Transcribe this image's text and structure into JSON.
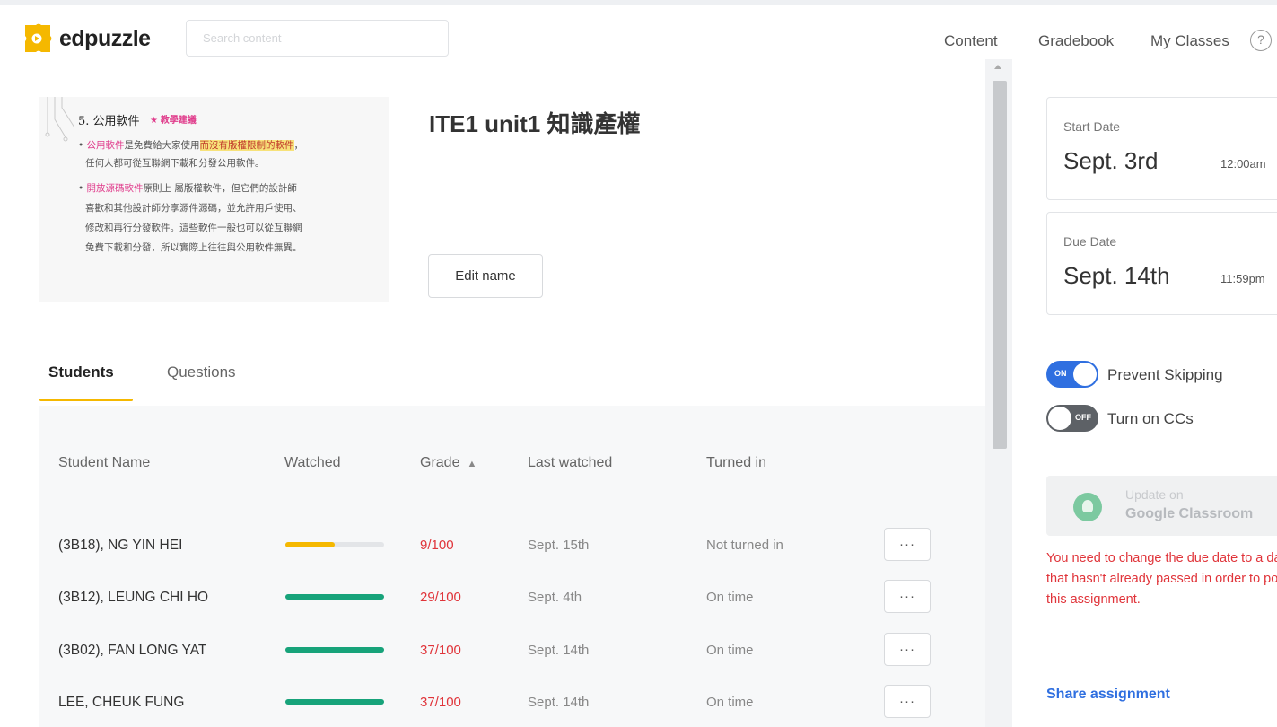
{
  "brand": {
    "name": "edpuzzle",
    "logo_color": "#f5b800"
  },
  "search": {
    "placeholder": "Search content"
  },
  "nav": {
    "links": [
      "Content",
      "Gradebook",
      "My Classes"
    ],
    "help_glyph": "?"
  },
  "assignment": {
    "title": "ITE1 unit1 知識產權",
    "edit_button": "Edit name",
    "thumbnail": {
      "heading": "5. 公用軟件",
      "tag": "★ 教學建議",
      "lines": [
        {
          "pre": "• ",
          "pink": "公用軟件",
          "mid": "是免費給大家使用",
          "hl": "而沒有版權限制的軟件",
          "post": "，"
        },
        {
          "pre": "",
          "pink": "",
          "mid": "任何人都可從互聯網下載和分發公用軟件。",
          "hl": "",
          "post": ""
        },
        {
          "pre": "• ",
          "pink": "開放源碼軟件",
          "mid": "原則上 屬版權軟件，但它們的設計師",
          "hl": "",
          "post": ""
        },
        {
          "pre": "",
          "pink": "",
          "mid": "喜歡和其他設計師分享源件源碼，並允許用戶使用、",
          "hl": "",
          "post": ""
        },
        {
          "pre": "",
          "pink": "",
          "mid": "修改和再行分發軟件。這些軟件一般也可以從互聯網",
          "hl": "",
          "post": ""
        },
        {
          "pre": "",
          "pink": "",
          "mid": "免費下載和分發，所以實際上往往與公用軟件無異。",
          "hl": "",
          "post": ""
        }
      ]
    }
  },
  "tabs": [
    {
      "label": "Students",
      "active": true
    },
    {
      "label": "Questions",
      "active": false
    }
  ],
  "table": {
    "columns": [
      "Student Name",
      "Watched",
      "Grade",
      "Last watched",
      "Turned in"
    ],
    "sort_indicator": "▲",
    "more_glyph": "···",
    "rows": [
      {
        "name": "(3B18), NG YIN HEI",
        "watched": 0.5,
        "bar_color": "#f5b800",
        "grade": "9/100",
        "last_watched": "Sept. 15th",
        "turned_in": "Not turned in"
      },
      {
        "name": "(3B12), LEUNG CHI HO",
        "watched": 1.0,
        "bar_color": "#17a37a",
        "grade": "29/100",
        "last_watched": "Sept. 4th",
        "turned_in": "On time"
      },
      {
        "name": "(3B02), FAN LONG YAT",
        "watched": 1.0,
        "bar_color": "#17a37a",
        "grade": "37/100",
        "last_watched": "Sept. 14th",
        "turned_in": "On time"
      },
      {
        "name": "LEE, CHEUK FUNG",
        "watched": 1.0,
        "bar_color": "#17a37a",
        "grade": "37/100",
        "last_watched": "Sept. 14th",
        "turned_in": "On time"
      }
    ]
  },
  "side": {
    "start": {
      "label": "Start Date",
      "date": "Sept. 3rd",
      "time": "12:00am"
    },
    "due": {
      "label": "Due Date",
      "date": "Sept. 14th",
      "time": "11:59pm"
    },
    "prevent_skipping": {
      "label": "Prevent Skipping",
      "state": "ON"
    },
    "captions": {
      "label": "Turn on CCs",
      "state": "OFF"
    },
    "google": {
      "line1": "Update on",
      "line2": "Google Classroom"
    },
    "warning": "You need to change the due date to a date that hasn't already passed in order to post this assignment.",
    "share": "Share assignment"
  }
}
